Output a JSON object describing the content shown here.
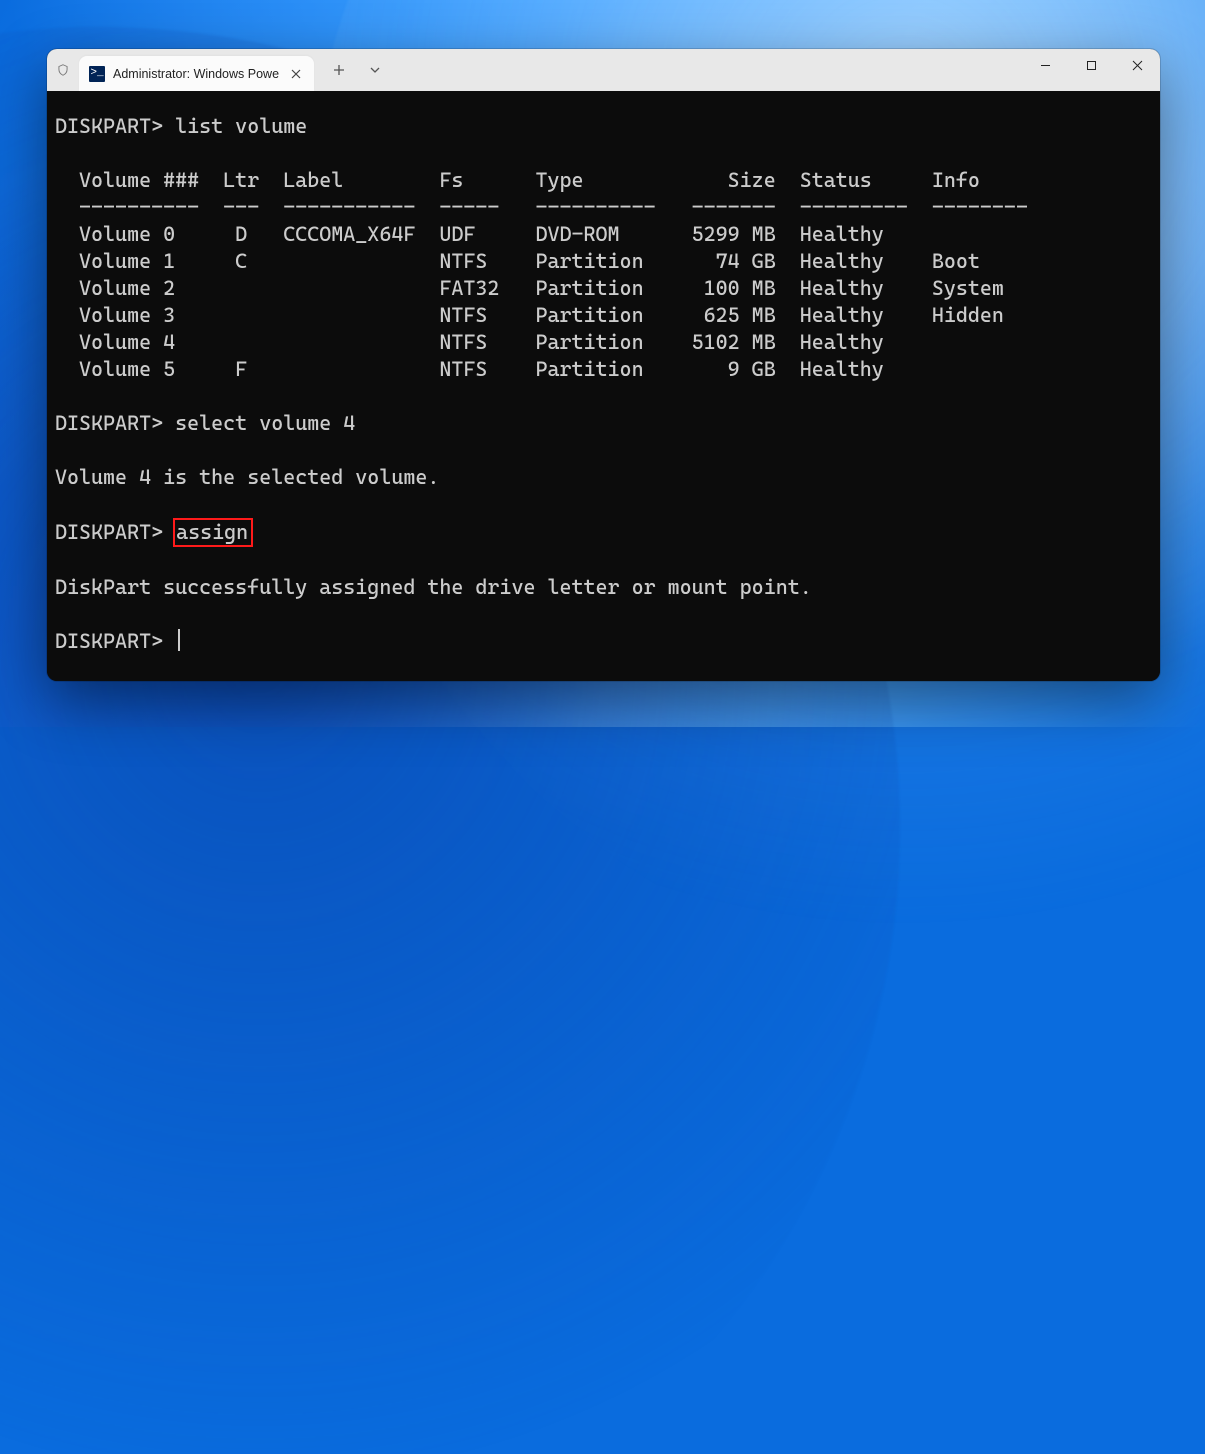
{
  "window": {
    "tab_title": "Administrator: Windows Powe",
    "tab_icon_glyph": ">_"
  },
  "terminal": {
    "prompt": "DISKPART>",
    "commands": {
      "list": "list volume",
      "select": "select volume 4",
      "assign": "assign"
    },
    "headers": {
      "volume": "Volume ###",
      "ltr": "Ltr",
      "label": "Label",
      "fs": "Fs",
      "type": "Type",
      "size": "Size",
      "status": "Status",
      "info": "Info"
    },
    "divider": {
      "volume": "----------",
      "ltr": "---",
      "label": "-----------",
      "fs": "-----",
      "type": "----------",
      "size": "-------",
      "status": "---------",
      "info": "--------"
    },
    "rows": [
      {
        "volume": "Volume 0",
        "ltr": "D",
        "label": "CCCOMA_X64F",
        "fs": "UDF",
        "type": "DVD-ROM",
        "size": "5299 MB",
        "status": "Healthy",
        "info": ""
      },
      {
        "volume": "Volume 1",
        "ltr": "C",
        "label": "",
        "fs": "NTFS",
        "type": "Partition",
        "size": "74 GB",
        "status": "Healthy",
        "info": "Boot"
      },
      {
        "volume": "Volume 2",
        "ltr": "",
        "label": "",
        "fs": "FAT32",
        "type": "Partition",
        "size": "100 MB",
        "status": "Healthy",
        "info": "System"
      },
      {
        "volume": "Volume 3",
        "ltr": "",
        "label": "",
        "fs": "NTFS",
        "type": "Partition",
        "size": "625 MB",
        "status": "Healthy",
        "info": "Hidden"
      },
      {
        "volume": "Volume 4",
        "ltr": "",
        "label": "",
        "fs": "NTFS",
        "type": "Partition",
        "size": "5102 MB",
        "status": "Healthy",
        "info": ""
      },
      {
        "volume": "Volume 5",
        "ltr": "F",
        "label": "",
        "fs": "NTFS",
        "type": "Partition",
        "size": "9 GB",
        "status": "Healthy",
        "info": ""
      }
    ],
    "messages": {
      "selected": "Volume 4 is the selected volume.",
      "assigned": "DiskPart successfully assigned the drive letter or mount point."
    }
  }
}
